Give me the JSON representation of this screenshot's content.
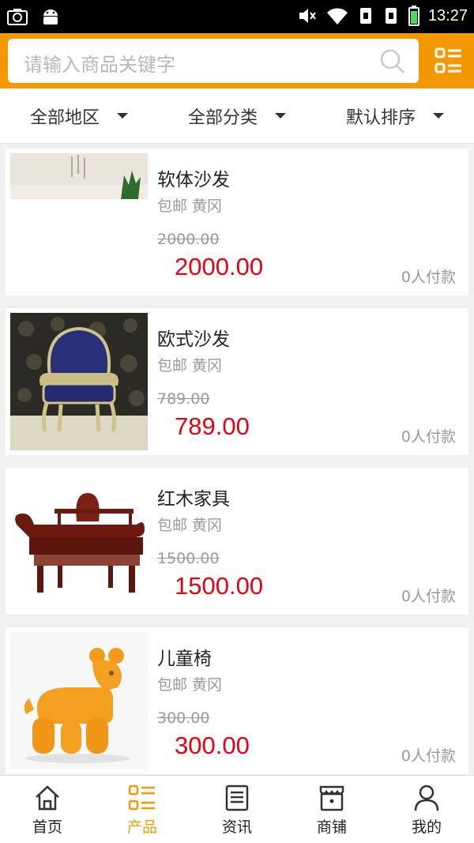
{
  "status_bar": {
    "time": "13:27"
  },
  "search": {
    "placeholder": "请输入商品关键字"
  },
  "filters": [
    {
      "label": "全部地区"
    },
    {
      "label": "全部分类"
    },
    {
      "label": "默认排序"
    }
  ],
  "products": [
    {
      "name": "软体沙发",
      "shipping": "包邮",
      "location": "黄冈",
      "original_price": "2000.00",
      "price": "2000.00",
      "paid": "0人付款",
      "image": "sofa-room-image"
    },
    {
      "name": "欧式沙发",
      "shipping": "包邮",
      "location": "黄冈",
      "original_price": "789.00",
      "price": "789.00",
      "paid": "0人付款",
      "image": "european-armchair-image"
    },
    {
      "name": "红木家具",
      "shipping": "包邮",
      "location": "黄冈",
      "original_price": "1500.00",
      "price": "1500.00",
      "paid": "0人付款",
      "image": "rosewood-daybed-image"
    },
    {
      "name": "儿童椅",
      "shipping": "包邮",
      "location": "黄冈",
      "original_price": "300.00",
      "price": "300.00",
      "paid": "0人付款",
      "image": "kids-pony-chair-image"
    }
  ],
  "tabs": [
    {
      "label": "首页",
      "icon": "home-icon"
    },
    {
      "label": "产品",
      "icon": "grid-list-icon",
      "active": true
    },
    {
      "label": "资讯",
      "icon": "news-icon"
    },
    {
      "label": "商铺",
      "icon": "shop-icon"
    },
    {
      "label": "我的",
      "icon": "person-icon"
    }
  ],
  "colors": {
    "brand": "#f39800",
    "price": "#e60012",
    "muted": "#999999"
  }
}
